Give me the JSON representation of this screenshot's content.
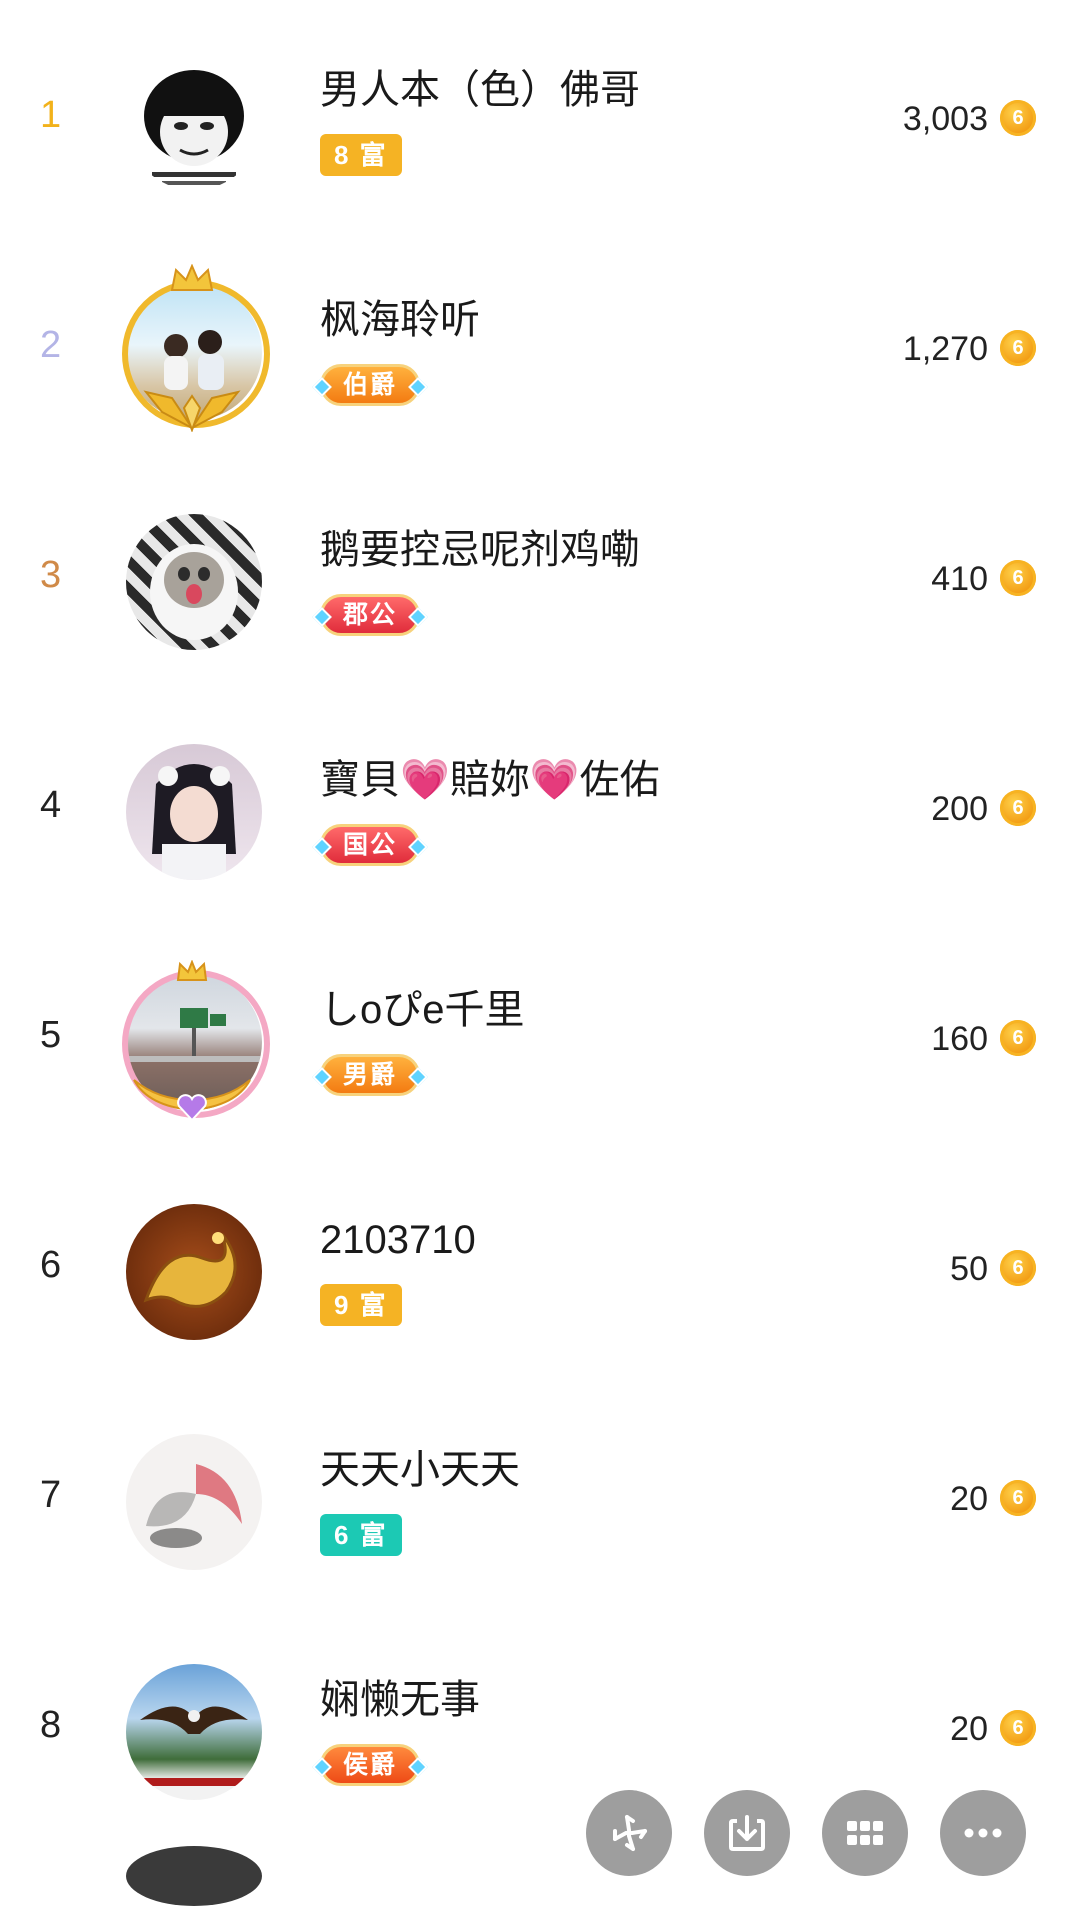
{
  "ranking": [
    {
      "rank": "1",
      "name": "男人本（色）佛哥",
      "badge": "8 富",
      "badge_style": "fu-gold",
      "score": "3,003"
    },
    {
      "rank": "2",
      "name": "枫海聆听",
      "badge": "伯爵",
      "badge_style": "orange",
      "score": "1,270"
    },
    {
      "rank": "3",
      "name": "鹅要控忌呢剂鸡嘞",
      "badge": "郡公",
      "badge_style": "red",
      "score": "410"
    },
    {
      "rank": "4",
      "name": "寶貝💗賠妳💗佐佑",
      "badge": "国公",
      "badge_style": "red",
      "score": "200"
    },
    {
      "rank": "5",
      "name": "しoぴe千里",
      "badge": "男爵",
      "badge_style": "orange",
      "score": "160"
    },
    {
      "rank": "6",
      "name": "2103710",
      "badge": "9 富",
      "badge_style": "fu-gold",
      "score": "50"
    },
    {
      "rank": "7",
      "name": "天天小天天",
      "badge": "6 富",
      "badge_style": "fu-teal",
      "score": "20"
    },
    {
      "rank": "8",
      "name": "娴懒无事",
      "badge": "侯爵",
      "badge_style": "orangered",
      "score": "20"
    }
  ],
  "coin_glyph": "6",
  "floating_toolbar": {
    "buttons": [
      "pinwheel-icon",
      "download-icon",
      "grid-icon",
      "more-icon"
    ]
  },
  "colors": {
    "rank1": "#f2b21b",
    "rank2": "#b3b4e6",
    "rank3": "#d08a48",
    "fu_gold": "#f5b324",
    "fu_teal": "#1cc9b4",
    "fab_gray": "#9e9e9e"
  }
}
